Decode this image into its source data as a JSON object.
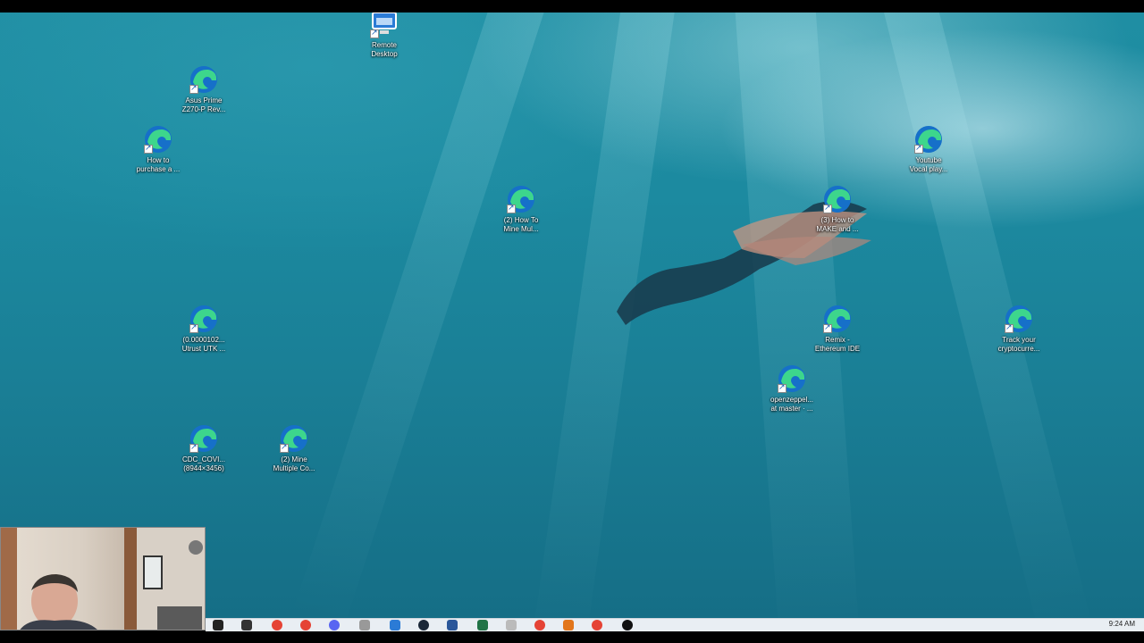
{
  "desktop_icons": [
    {
      "label": "Remote\nDesktop",
      "icon": "remote-desktop-icon"
    },
    {
      "label": "Asus Prime\nZ270-P Rev...",
      "icon": "edge-icon"
    },
    {
      "label": "How to\npurchase a ...",
      "icon": "edge-icon"
    },
    {
      "label": "(2) How To\nMine Mul...",
      "icon": "edge-icon"
    },
    {
      "label": "(3) How to\nMAKE and ...",
      "icon": "edge-icon"
    },
    {
      "label": "Youtube\nVocal play...",
      "icon": "edge-icon"
    },
    {
      "label": "(0.0000102...\nUtrust UTK ...",
      "icon": "edge-icon"
    },
    {
      "label": "Remix -\nEthereum IDE",
      "icon": "edge-icon"
    },
    {
      "label": "Track your\ncryptocurre...",
      "icon": "edge-icon"
    },
    {
      "label": "openzeppel...\nat master · ...",
      "icon": "edge-icon"
    },
    {
      "label": "CDC_COVI...\n(8944×3456)",
      "icon": "edge-icon"
    },
    {
      "label": "(2) Mine\nMultiple Co...",
      "icon": "edge-icon"
    }
  ],
  "taskbar": {
    "clock": "9:24 AM",
    "apps": [
      "task-view-icon",
      "app-icon",
      "chrome-icon",
      "chrome-icon",
      "discord-icon",
      "app-icon",
      "mail-icon",
      "steam-icon",
      "word-icon",
      "excel-icon",
      "file-icon",
      "chrome-icon",
      "metamask-icon",
      "chrome-icon",
      "obs-icon"
    ]
  },
  "colors": {
    "water": "#1c8aa0",
    "taskbar": "#e9eef3"
  }
}
